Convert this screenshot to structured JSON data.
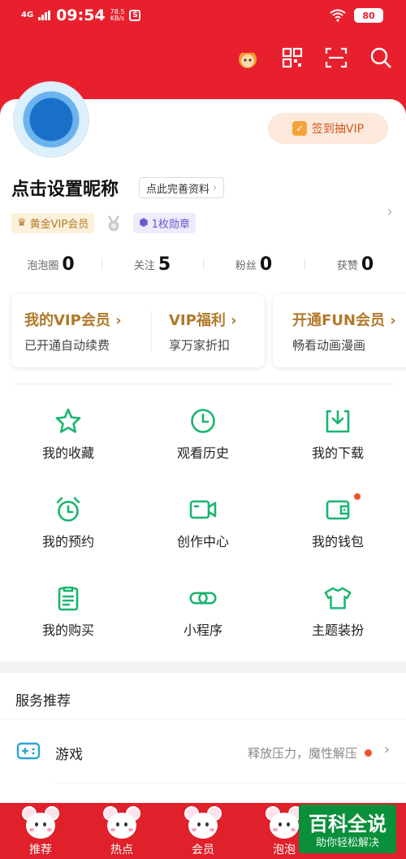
{
  "status_bar": {
    "network": "4G",
    "time": "09:54",
    "speed_value": "78.5",
    "speed_unit": "KB/s",
    "battery": "80"
  },
  "profile": {
    "signin_label": "签到抽VIP",
    "nickname": "点击设置昵称",
    "complete_info": "点此完善资料",
    "vip_badge": "黄金VIP会员",
    "medal_badge": "1枚勋章"
  },
  "stats": [
    {
      "label": "泡泡圈",
      "value": "0"
    },
    {
      "label": "关注",
      "value": "5"
    },
    {
      "label": "粉丝",
      "value": "0"
    },
    {
      "label": "获赞",
      "value": "0"
    }
  ],
  "vip_cards": [
    {
      "title": "我的VIP会员 ›",
      "subtitle": "已开通自动续费"
    },
    {
      "title": "VIP福利 ›",
      "subtitle": "享万家折扣"
    },
    {
      "title": "开通FUN会员 ›",
      "subtitle": "畅看动画漫画"
    }
  ],
  "grid": [
    {
      "label": "我的收藏",
      "icon": "star-icon"
    },
    {
      "label": "观看历史",
      "icon": "clock-icon"
    },
    {
      "label": "我的下载",
      "icon": "download-icon"
    },
    {
      "label": "我的预约",
      "icon": "alarm-icon"
    },
    {
      "label": "创作中心",
      "icon": "video-camera-icon"
    },
    {
      "label": "我的钱包",
      "icon": "wallet-icon"
    },
    {
      "label": "我的购买",
      "icon": "clipboard-icon"
    },
    {
      "label": "小程序",
      "icon": "link-icon"
    },
    {
      "label": "主题装扮",
      "icon": "tshirt-icon"
    }
  ],
  "services": {
    "title": "服务推荐",
    "items": [
      {
        "name": "游戏",
        "desc": "释放压力，魔性解压"
      }
    ]
  },
  "tabbar": [
    {
      "label": "推荐"
    },
    {
      "label": "热点"
    },
    {
      "label": "会员"
    },
    {
      "label": "泡泡"
    }
  ],
  "watermark": {
    "title": "百科全说",
    "subtitle": "助你轻松解决"
  },
  "colors": {
    "brand_red": "#e8202e",
    "icon_green": "#19b56f",
    "vip_gold": "#b07a2a"
  }
}
